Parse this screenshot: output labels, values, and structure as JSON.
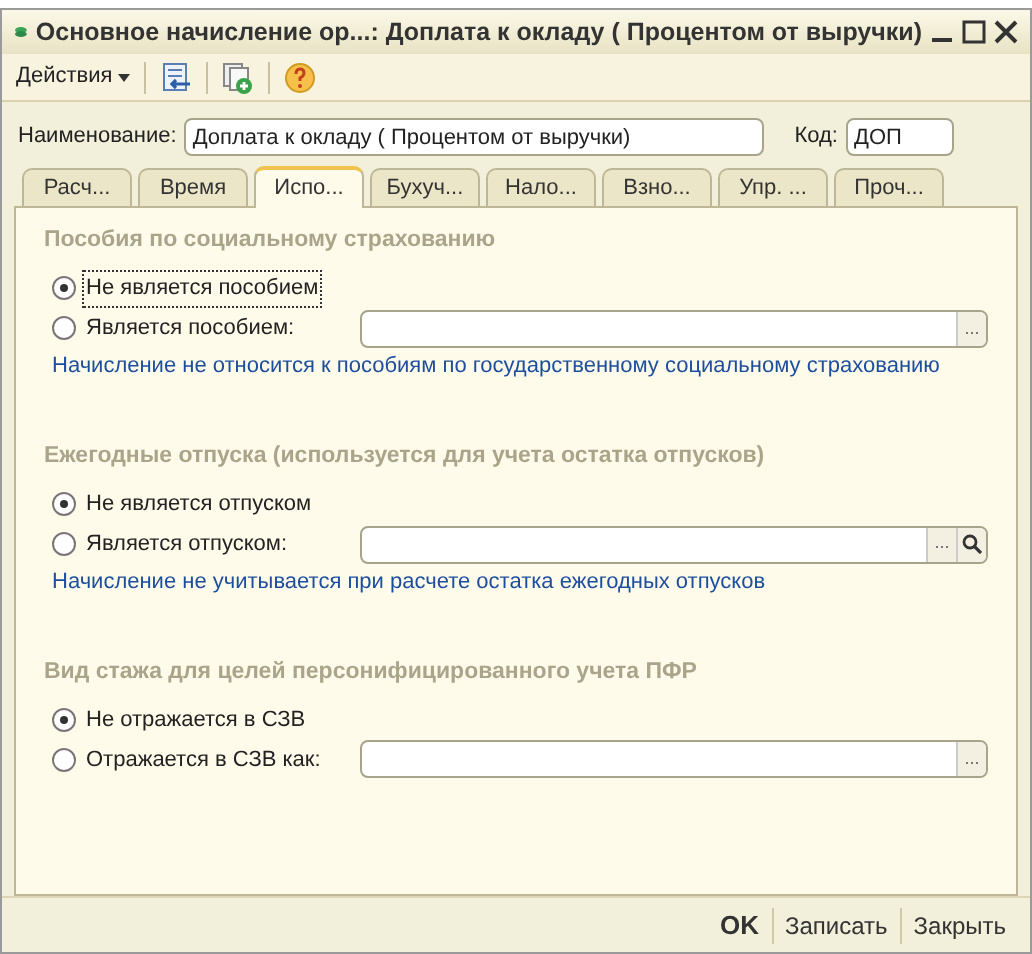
{
  "window": {
    "title": "Основное начисление ор...: Доплата к окладу ( Процентом от выручки)"
  },
  "toolbar": {
    "actions_menu": "Действия"
  },
  "name_field": {
    "label": "Наименование:",
    "value": "Доплата к окладу ( Процентом от выручки)"
  },
  "code_field": {
    "label": "Код:",
    "value": "ДОП"
  },
  "tabs": [
    {
      "label": "Расч...",
      "selected": false
    },
    {
      "label": "Время",
      "selected": false
    },
    {
      "label": "Испо...",
      "selected": true
    },
    {
      "label": "Бухуч...",
      "selected": false
    },
    {
      "label": "Нало...",
      "selected": false
    },
    {
      "label": "Взно...",
      "selected": false
    },
    {
      "label": "Упр. ...",
      "selected": false
    },
    {
      "label": "Проч...",
      "selected": false
    }
  ],
  "sections": [
    {
      "heading": "Пособия по социальному страхованию",
      "options": [
        {
          "label": "Не является пособием",
          "selected": true
        },
        {
          "label": "Является пособием:",
          "selected": false
        }
      ],
      "field": {
        "select_button": "...",
        "search": false
      },
      "note": "Начисление не относится к пособиям по государственному социальному страхованию"
    },
    {
      "heading": "Ежегодные отпуска (используется для учета остатка отпусков)",
      "options": [
        {
          "label": "Не является отпуском",
          "selected": true
        },
        {
          "label": "Является отпуском:",
          "selected": false
        }
      ],
      "field": {
        "select_button": "...",
        "search": true
      },
      "note": "Начисление не учитывается при расчете остатка ежегодных отпусков"
    },
    {
      "heading": "Вид стажа для целей персонифицированного учета ПФР",
      "options": [
        {
          "label": "Не отражается в СЗВ",
          "selected": true
        },
        {
          "label": "Отражается в СЗВ как:",
          "selected": false
        }
      ],
      "field": {
        "select_button": "...",
        "search": false
      }
    }
  ],
  "buttons": [
    {
      "label": "OK",
      "default": true
    },
    {
      "label": "Записать",
      "default": false
    },
    {
      "label": "Закрыть",
      "default": false
    }
  ]
}
